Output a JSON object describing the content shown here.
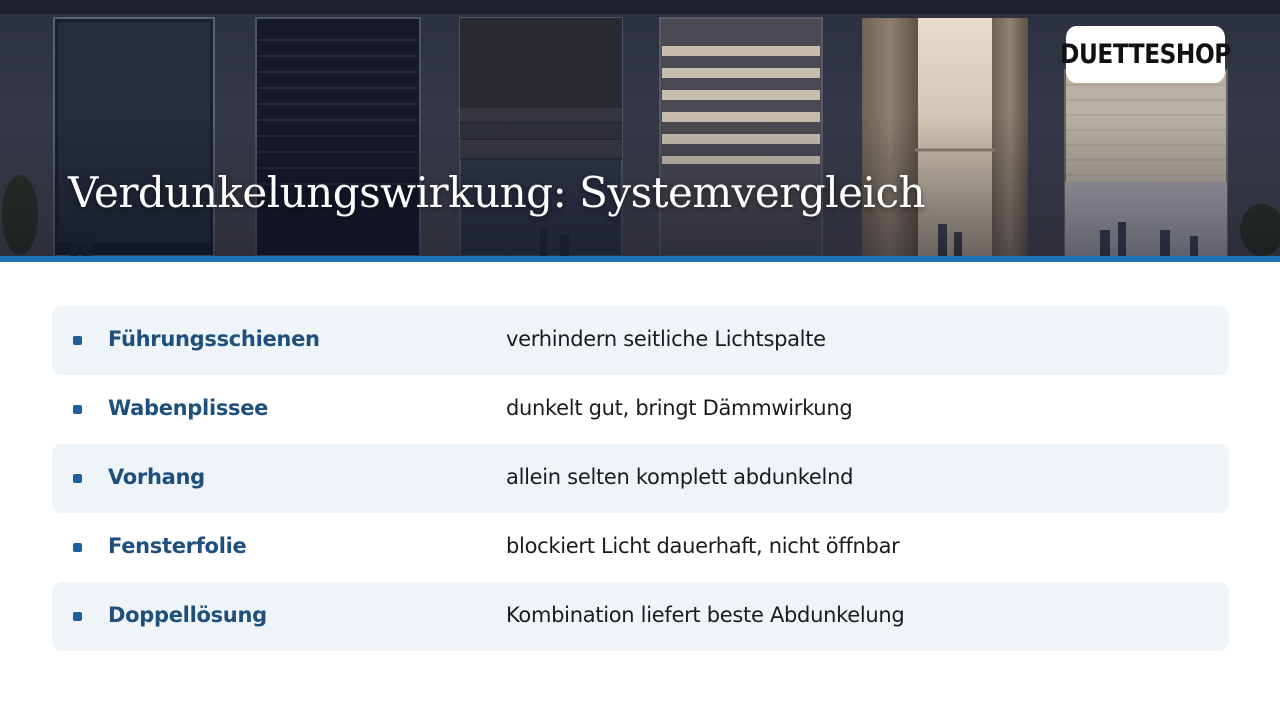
{
  "header": {
    "title": "Verdunkelungswirkung: Systemvergleich",
    "logo_text": "DUETTESHOP"
  },
  "comparison": [
    {
      "term": "Führungsschienen",
      "description": "verhindern seitliche Lichtspalte",
      "shaded": true
    },
    {
      "term": "Wabenplissee",
      "description": "dunkelt gut, bringt Dämmwirkung",
      "shaded": false
    },
    {
      "term": "Vorhang",
      "description": "allein selten komplett abdunkelnd",
      "shaded": true
    },
    {
      "term": "Fensterfolie",
      "description": "blockiert Licht dauerhaft, nicht öffnbar",
      "shaded": false
    },
    {
      "term": "Doppellösung",
      "description": "Kombination liefert beste Abdunkelung",
      "shaded": true
    }
  ],
  "colors": {
    "accent": "#1f6fb6",
    "term_text": "#1e4f7d",
    "row_shade": "#eff4f9"
  }
}
